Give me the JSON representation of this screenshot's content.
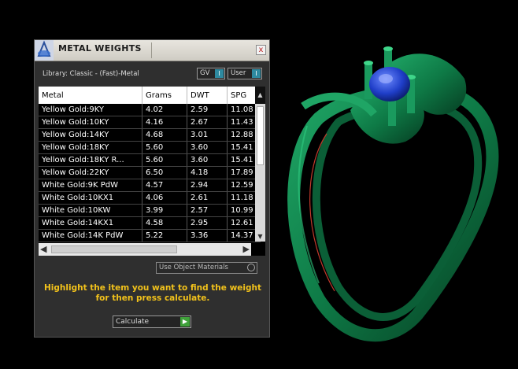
{
  "window": {
    "title": "METAL WEIGHTS",
    "close_symbol": "x"
  },
  "library": {
    "label": "Library: Classic - (Fast)-Metal"
  },
  "toggles": {
    "gv_label": "GV",
    "gv_indicator": "I",
    "user_label": "User",
    "user_indicator": "I"
  },
  "table": {
    "headers": [
      "Metal",
      "Grams",
      "DWT",
      "SPG"
    ],
    "rows": [
      [
        "Yellow Gold:9KY",
        "4.02",
        "2.59",
        "11.08"
      ],
      [
        "Yellow Gold:10KY",
        "4.16",
        "2.67",
        "11.43"
      ],
      [
        "Yellow Gold:14KY",
        "4.68",
        "3.01",
        "12.88"
      ],
      [
        "Yellow Gold:18KY",
        "5.60",
        "3.60",
        "15.41"
      ],
      [
        "Yellow Gold:18KY R...",
        "5.60",
        "3.60",
        "15.41"
      ],
      [
        "Yellow Gold:22KY",
        "6.50",
        "4.18",
        "17.89"
      ],
      [
        "White Gold:9K PdW",
        "4.57",
        "2.94",
        "12.59"
      ],
      [
        "White Gold:10KX1",
        "4.06",
        "2.61",
        "11.18"
      ],
      [
        "White Gold:10KW",
        "3.99",
        "2.57",
        "10.99"
      ],
      [
        "White Gold:14KX1",
        "4.58",
        "2.95",
        "12.61"
      ],
      [
        "White Gold:14K PdW",
        "5.22",
        "3.36",
        "14.37"
      ]
    ]
  },
  "use_object_materials": {
    "label": "Use Object Materials"
  },
  "hint": {
    "text": "Highlight the item you want to find the weight for then press calculate."
  },
  "calculate": {
    "label": "Calculate",
    "go_symbol": "▶"
  },
  "colors": {
    "ring_green": "#0e7a46",
    "stone_blue": "#1f3ec8",
    "hint_yellow": "#f2c21b",
    "accent_teal": "#2e8aa0"
  },
  "icons": {
    "app_logo": "app-logo-icon",
    "close": "close-icon",
    "calculate": "play-icon"
  }
}
